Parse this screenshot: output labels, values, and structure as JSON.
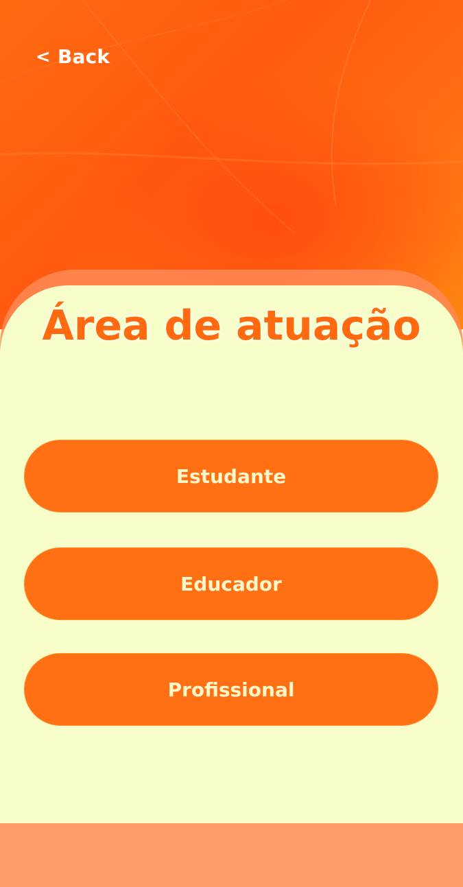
{
  "header": {
    "back_chevron": "<",
    "back_label": "Back"
  },
  "main": {
    "title": "Área de atuação",
    "options": [
      {
        "label": "Estudante"
      },
      {
        "label": "Educador"
      },
      {
        "label": "Profissional"
      }
    ]
  },
  "colors": {
    "accent": "#ff6a10",
    "button_bg": "#ff7014",
    "button_text": "#fdf6c8",
    "panel_bg": "#f6fdc9"
  }
}
